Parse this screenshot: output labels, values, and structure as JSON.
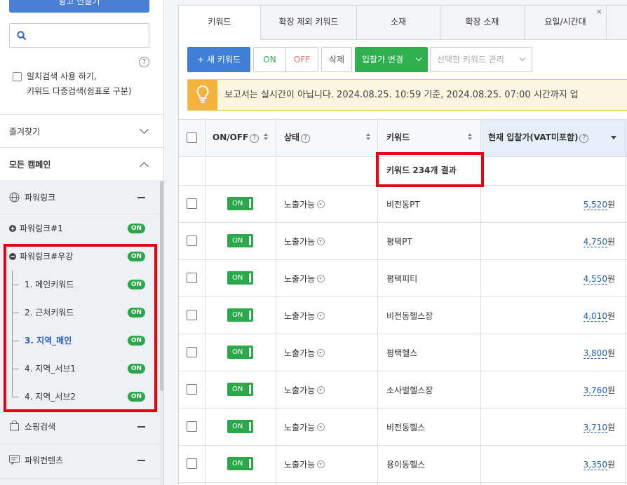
{
  "sidebar": {
    "top_button_label": "광고 만들기",
    "search_placeholder": "",
    "help_glyph": "?",
    "exact_search_label_line1": "일치검색 사용 하기,",
    "exact_search_label_line2": "키워드 다중검색(쉼표로 구분)",
    "favorites_label": "즐겨찾기",
    "all_campaigns_label": "모든 캠페인",
    "toggle_label": "ON",
    "groups": [
      {
        "label": "파워링크",
        "icon": "globe-icon"
      },
      {
        "label": "쇼핑검색",
        "icon": "shopping-bag-icon"
      },
      {
        "label": "파워컨텐츠",
        "icon": "content-card-icon"
      }
    ],
    "campaigns": [
      {
        "label": "파워링크#1",
        "status": "ON"
      },
      {
        "label": "파워링크#우강",
        "status": "ON"
      }
    ],
    "adgroups": [
      {
        "label": "1. 메인키워드",
        "status": "ON"
      },
      {
        "label": "2. 근처키워드",
        "status": "ON"
      },
      {
        "label": "3. 지역_메인",
        "status": "ON"
      },
      {
        "label": "4. 지역_서브1",
        "status": "ON"
      },
      {
        "label": "4. 지역_서브2",
        "status": "ON"
      }
    ]
  },
  "tabs": [
    {
      "label": "키워드",
      "active": true
    },
    {
      "label": "확장 제외 키워드",
      "active": false
    },
    {
      "label": "소재",
      "active": false
    },
    {
      "label": "확장 소재",
      "active": false
    },
    {
      "label": "요일/시간대",
      "active": false
    }
  ],
  "tab_close_glyph": "×",
  "toolbar": {
    "new_keyword": "+ 새 키워드",
    "on": "ON",
    "off": "OFF",
    "delete": "삭제",
    "bid_change": "입찰가 변경",
    "manage_selected": "선택한 키워드 관리"
  },
  "notice": {
    "text": "보고서는 실시간이 아닙니다. 2024.08.25. 10:59 기준, 2024.08.25. 07:00 시간까지 업"
  },
  "table": {
    "columns": [
      "ON/OFF",
      "상태",
      "키워드",
      "현재 입찰가(VAT미포함)"
    ],
    "help_glyph": "?",
    "result_text": "키워드 234개 결과",
    "rows": [
      {
        "toggle": "ON",
        "status": "노출가능",
        "keyword": "비전동PT",
        "bid": "5,520",
        "unit": "원"
      },
      {
        "toggle": "ON",
        "status": "노출가능",
        "keyword": "평택PT",
        "bid": "4,750",
        "unit": "원"
      },
      {
        "toggle": "ON",
        "status": "노출가능",
        "keyword": "평택피티",
        "bid": "4,550",
        "unit": "원"
      },
      {
        "toggle": "ON",
        "status": "노출가능",
        "keyword": "비전동헬스장",
        "bid": "4,010",
        "unit": "원"
      },
      {
        "toggle": "ON",
        "status": "노출가능",
        "keyword": "평택헬스",
        "bid": "3,800",
        "unit": "원"
      },
      {
        "toggle": "ON",
        "status": "노출가능",
        "keyword": "소사벌헬스장",
        "bid": "3,760",
        "unit": "원"
      },
      {
        "toggle": "ON",
        "status": "노출가능",
        "keyword": "비전동헬스",
        "bid": "3,710",
        "unit": "원"
      },
      {
        "toggle": "ON",
        "status": "노출가능",
        "keyword": "용이동헬스",
        "bid": "3,350",
        "unit": "원"
      }
    ]
  },
  "colors": {
    "primary_blue": "#3f7fd8",
    "on_green": "#2aa84a",
    "highlight_red": "#e30613",
    "notice_bg": "#fcf6e1",
    "notice_icon": "#f3b33d",
    "selected_link": "#2f63c4"
  }
}
